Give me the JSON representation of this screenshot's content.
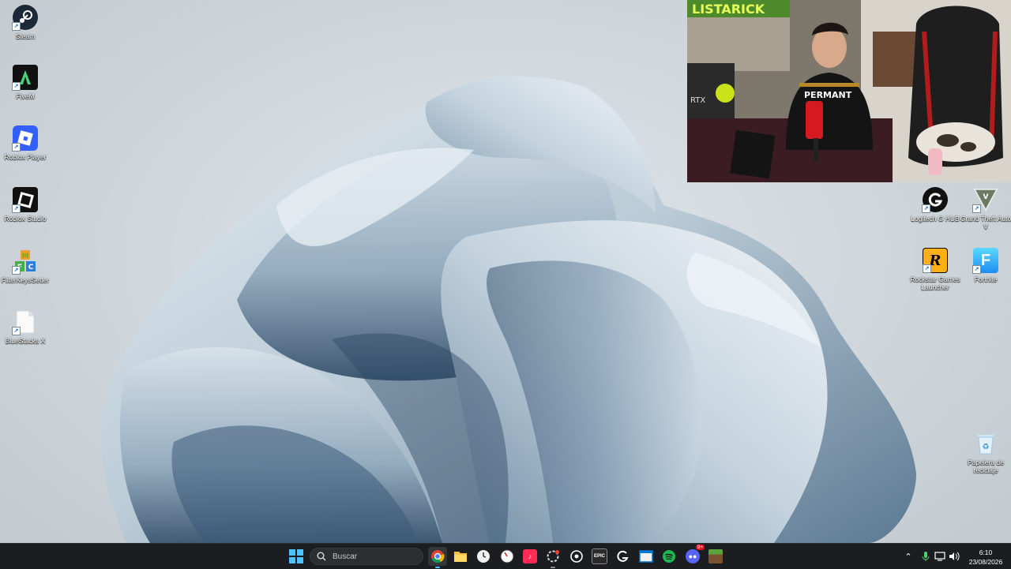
{
  "desktop": {
    "left_icons": [
      {
        "label": "Steam",
        "icon": "steam-icon"
      },
      {
        "label": "FiveM",
        "icon": "fivem-icon"
      },
      {
        "label": "Roblox Player",
        "icon": "roblox-player-icon"
      },
      {
        "label": "Roblox Studio",
        "icon": "roblox-studio-icon"
      },
      {
        "label": "FilterKeysSetter",
        "icon": "filterkeyssetter-icon"
      },
      {
        "label": "BlueStacks X",
        "icon": "bluestacks-icon"
      }
    ],
    "right_icons": [
      {
        "label": "Logitech G HUB",
        "icon": "logitech-ghub-icon"
      },
      {
        "label": "Grand Theft Auto V",
        "icon": "gta-v-icon"
      },
      {
        "label": "Rockstar Games Launcher",
        "icon": "rockstar-icon"
      },
      {
        "label": "Fortnite",
        "icon": "fortnite-icon"
      },
      {
        "label": "Papelera de reciclaje",
        "icon": "recycle-bin-icon"
      }
    ]
  },
  "webcam": {
    "sign_text": "LISTARICK",
    "shirt_text": "PERMANT",
    "monitor_text": "RTX"
  },
  "taskbar": {
    "search_placeholder": "Buscar",
    "apps": [
      "windows-start-icon",
      "chrome-icon",
      "file-explorer-icon",
      "clock-app-icon",
      "speedometer-icon",
      "tiktok-icon",
      "steelseries-icon",
      "steam-taskbar-icon",
      "epic-games-icon",
      "logitech-taskbar-icon",
      "window-app-icon",
      "spotify-icon",
      "discord-icon",
      "minecraft-icon"
    ],
    "epic_label": "EPIC",
    "discord_badge": "9+",
    "clock_time": "6:10",
    "clock_date": "23/08/2026"
  },
  "colors": {
    "taskbar_bg": "#1c1d20",
    "accent": "#0078d4"
  }
}
